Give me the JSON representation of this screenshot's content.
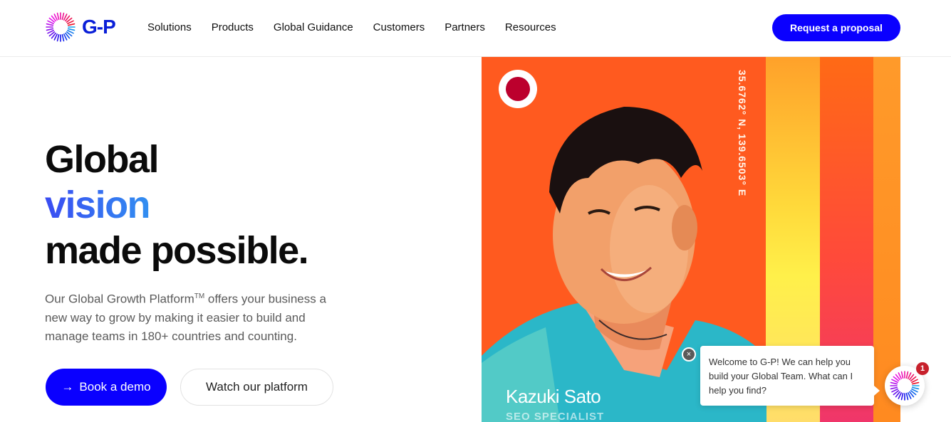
{
  "header": {
    "logo_text": "G-P",
    "nav": [
      "Solutions",
      "Products",
      "Global Guidance",
      "Customers",
      "Partners",
      "Resources"
    ],
    "cta_label": "Request a proposal"
  },
  "hero": {
    "title_line1": "Global",
    "title_line2": "vision",
    "title_line3": "made possible.",
    "description_part1": "Our Global Growth Platform",
    "description_tm": "TM",
    "description_part2": " offers your business a new way to grow by making it easier to build and manage teams in 180+ countries and counting.",
    "primary_button_icon": "→",
    "primary_button_label": "Book a demo",
    "secondary_button_label": "Watch our platform"
  },
  "feature_image": {
    "coordinates": "35.6762° N, 139.6503° E",
    "name": "Kazuki Sato",
    "role": "SEO SPECIALIST",
    "flag_icon": "japan-flag-icon"
  },
  "chat": {
    "close_glyph": "×",
    "message": "Welcome to G-P! We can help you build your Global Team. What can I help you find?",
    "badge_count": "1"
  },
  "colors": {
    "brand_blue": "#0a00ff",
    "logo_blue": "#0a1fd8",
    "hero_orange": "#ff5a1f"
  }
}
